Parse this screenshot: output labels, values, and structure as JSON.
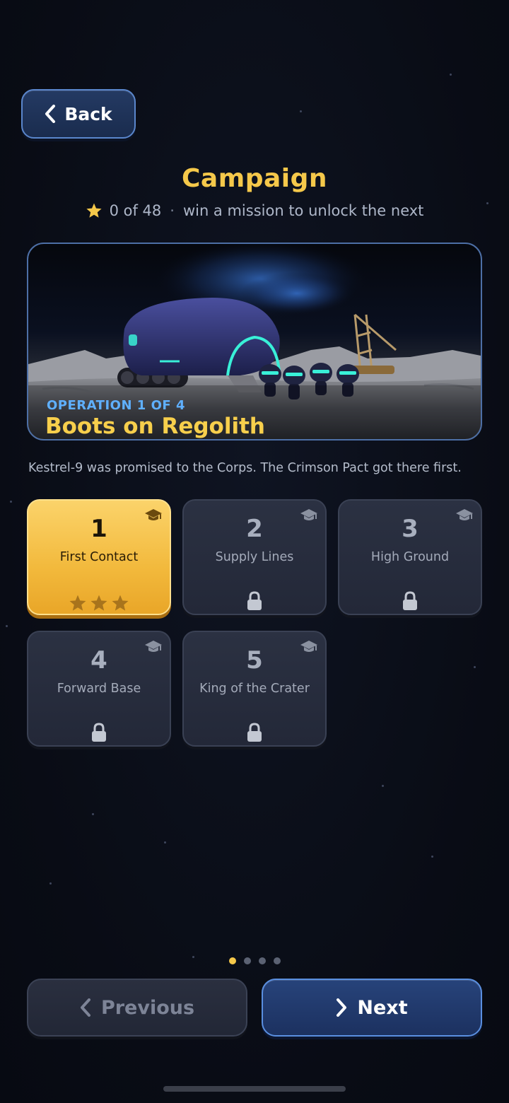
{
  "header": {
    "back_label": "Back",
    "title": "Campaign",
    "stars_progress": "0 of 48",
    "separator": "·",
    "hint": "win a mission to unlock the next"
  },
  "operation": {
    "label": "OPERATION 1 OF 4",
    "title": "Boots on Regolith",
    "description": "Kestrel-9 was promised to the Corps. The Crimson Pact got there first."
  },
  "missions": [
    {
      "number": "1",
      "name": "First Contact",
      "state": "unlocked",
      "stars_earned": 0,
      "stars_total": 3
    },
    {
      "number": "2",
      "name": "Supply Lines",
      "state": "locked"
    },
    {
      "number": "3",
      "name": "High Ground",
      "state": "locked"
    },
    {
      "number": "4",
      "name": "Forward Base",
      "state": "locked"
    },
    {
      "number": "5",
      "name": "King of the Crater",
      "state": "locked"
    }
  ],
  "pager": {
    "current": 1,
    "total": 4
  },
  "footer": {
    "previous_label": "Previous",
    "next_label": "Next"
  },
  "colors": {
    "accent_gold": "#f5c84a",
    "accent_blue": "#5fb0ff",
    "background": "#0b0f19"
  },
  "icons": [
    "chevron-left-icon",
    "star-icon",
    "graduation-cap-icon",
    "lock-icon",
    "chevron-right-icon"
  ]
}
